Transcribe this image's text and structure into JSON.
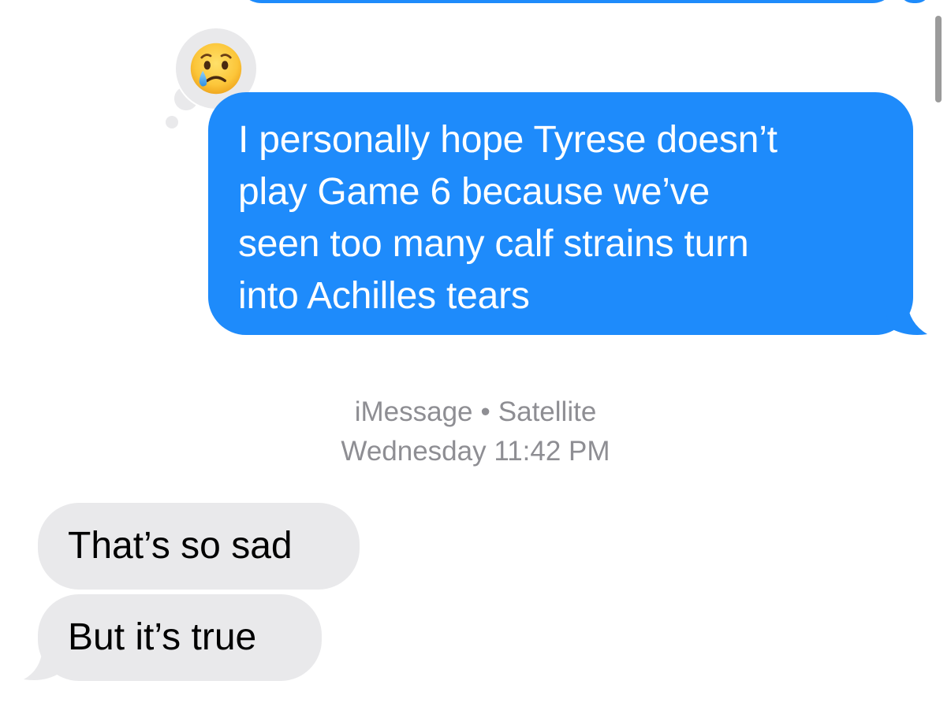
{
  "conversation": {
    "tapback": {
      "emoji": "crying-face"
    },
    "outgoing_message": {
      "text_lines": [
        "I personally hope Tyrese doesn’t",
        "play Game 6 because we’ve",
        "seen too many calf strains turn",
        "into Achilles tears"
      ]
    },
    "timestamp": {
      "service": "iMessage",
      "separator": "•",
      "network": "Satellite",
      "datetime": "Wednesday 11:42 PM"
    },
    "incoming_messages": [
      {
        "text": "That’s so sad"
      },
      {
        "text": "But it’s true"
      }
    ]
  },
  "colors": {
    "outgoing_bubble": "#1e8bfb",
    "incoming_bubble": "#e9e9eb",
    "meta_text": "#8e8e93"
  }
}
